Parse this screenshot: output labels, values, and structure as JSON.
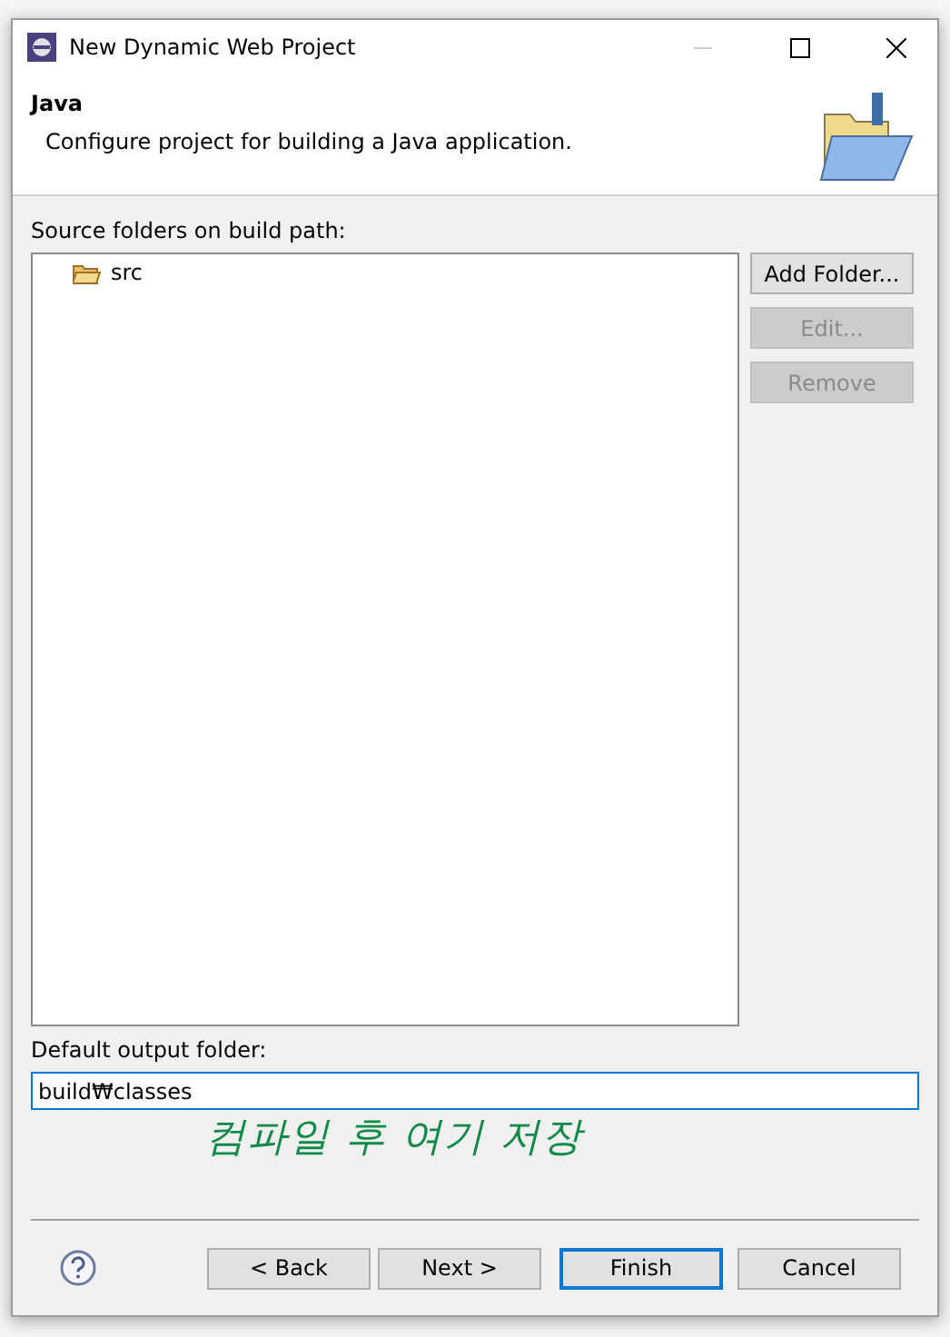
{
  "window": {
    "title": "New Dynamic Web Project"
  },
  "header": {
    "title": "Java",
    "description": "Configure project for building a Java application."
  },
  "source_folders": {
    "label": "Source folders on build path:",
    "items": [
      {
        "name": "src"
      }
    ]
  },
  "side_buttons": [
    {
      "label": "Add Folder...",
      "disabled": false
    },
    {
      "label": "Edit...",
      "disabled": true
    },
    {
      "label": "Remove",
      "disabled": true
    }
  ],
  "output_folder": {
    "label": "Default output folder:",
    "value": "build₩classes"
  },
  "annotation": "컴파일 후 여기 저장",
  "footer_buttons": [
    {
      "label": "< Back",
      "default": false
    },
    {
      "label": "Next >",
      "default": false
    },
    {
      "label": "Finish",
      "default": true
    },
    {
      "label": "Cancel",
      "default": false
    }
  ]
}
